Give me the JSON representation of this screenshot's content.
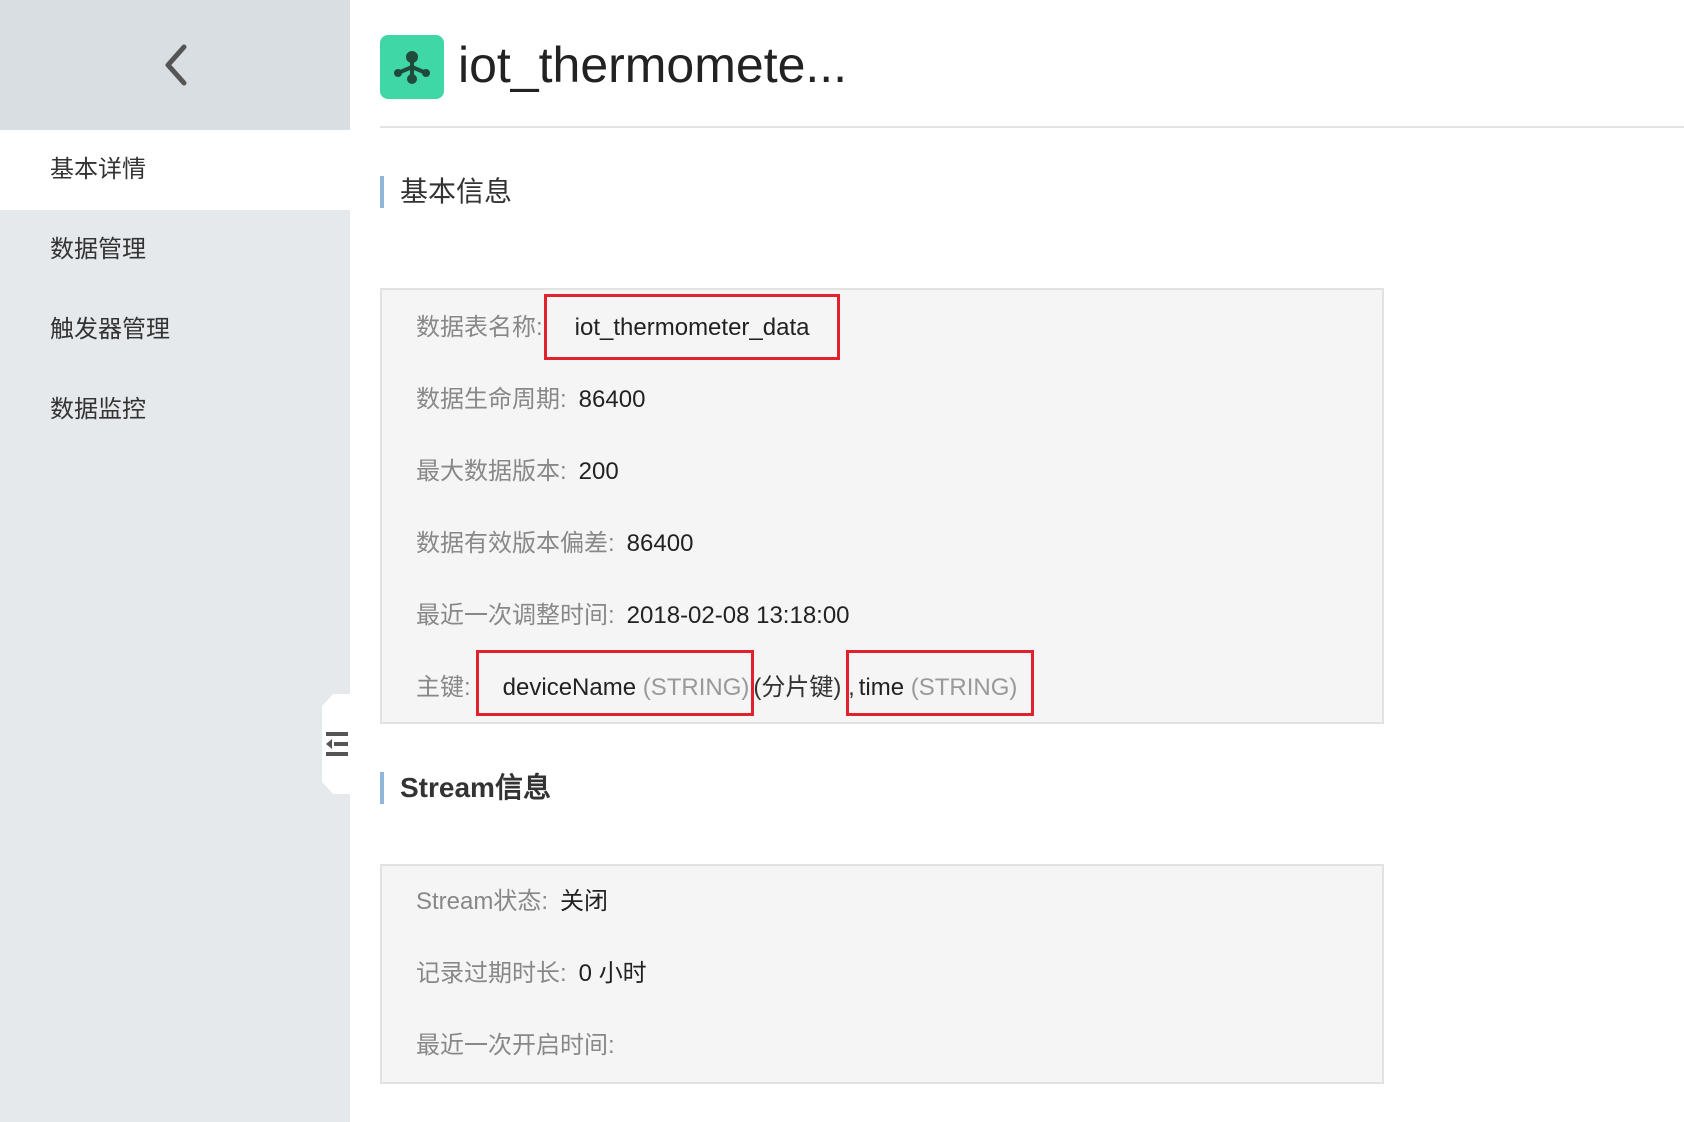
{
  "header": {
    "title": "iot_thermomete..."
  },
  "sidebar": {
    "items": [
      {
        "label": "基本详情"
      },
      {
        "label": "数据管理"
      },
      {
        "label": "触发器管理"
      },
      {
        "label": "数据监控"
      }
    ]
  },
  "basic_info": {
    "title": "基本信息",
    "table_name_label": "数据表名称:",
    "table_name_value": "iot_thermometer_data",
    "ttl_label": "数据生命周期:",
    "ttl_value": "86400",
    "max_versions_label": "最大数据版本:",
    "max_versions_value": "200",
    "version_offset_label": "数据有效版本偏差:",
    "version_offset_value": "86400",
    "last_adjust_label": "最近一次调整时间:",
    "last_adjust_value": "2018-02-08 13:18:00",
    "primary_key_label": "主键:",
    "pk1_name": "deviceName",
    "pk1_type": "(STRING)",
    "pk1_note": "(分片键)",
    "pk_sep": ",",
    "pk2_name": "time",
    "pk2_type": "(STRING)"
  },
  "stream_info": {
    "title": "Stream信息",
    "status_label": "Stream状态:",
    "status_value": "关闭",
    "expire_label": "记录过期时长:",
    "expire_value": "0 小时",
    "last_open_label": "最近一次开启时间:"
  },
  "colors": {
    "accent": "#3fd7a6",
    "highlight": "#e0222f",
    "section_bar": "#8fb6d8"
  },
  "icons": {
    "back": "chevron-left-icon",
    "app": "share-node-icon",
    "collapse": "collapse-menu-icon"
  }
}
